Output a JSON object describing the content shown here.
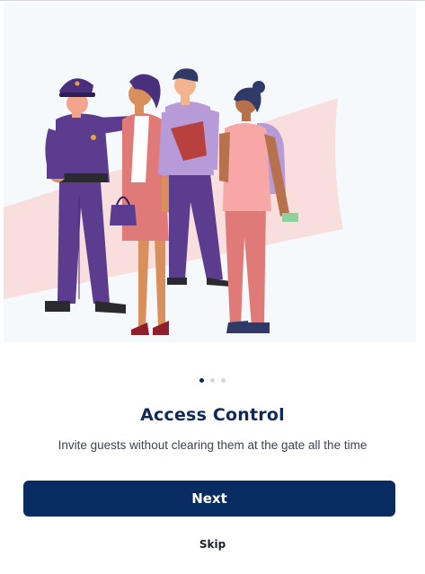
{
  "onboarding": {
    "illustration": "access-control-people-illustration",
    "pager": {
      "total": 3,
      "active": 1
    },
    "title": "Access Control",
    "subtitle": "Invite guests without clearing them at the gate all the time",
    "next_label": "Next",
    "skip_label": "Skip"
  },
  "colors": {
    "primary": "#082b61",
    "title": "#0f2a57",
    "dot_inactive": "#d2d5da",
    "hero_background": "#f6f9fc"
  }
}
